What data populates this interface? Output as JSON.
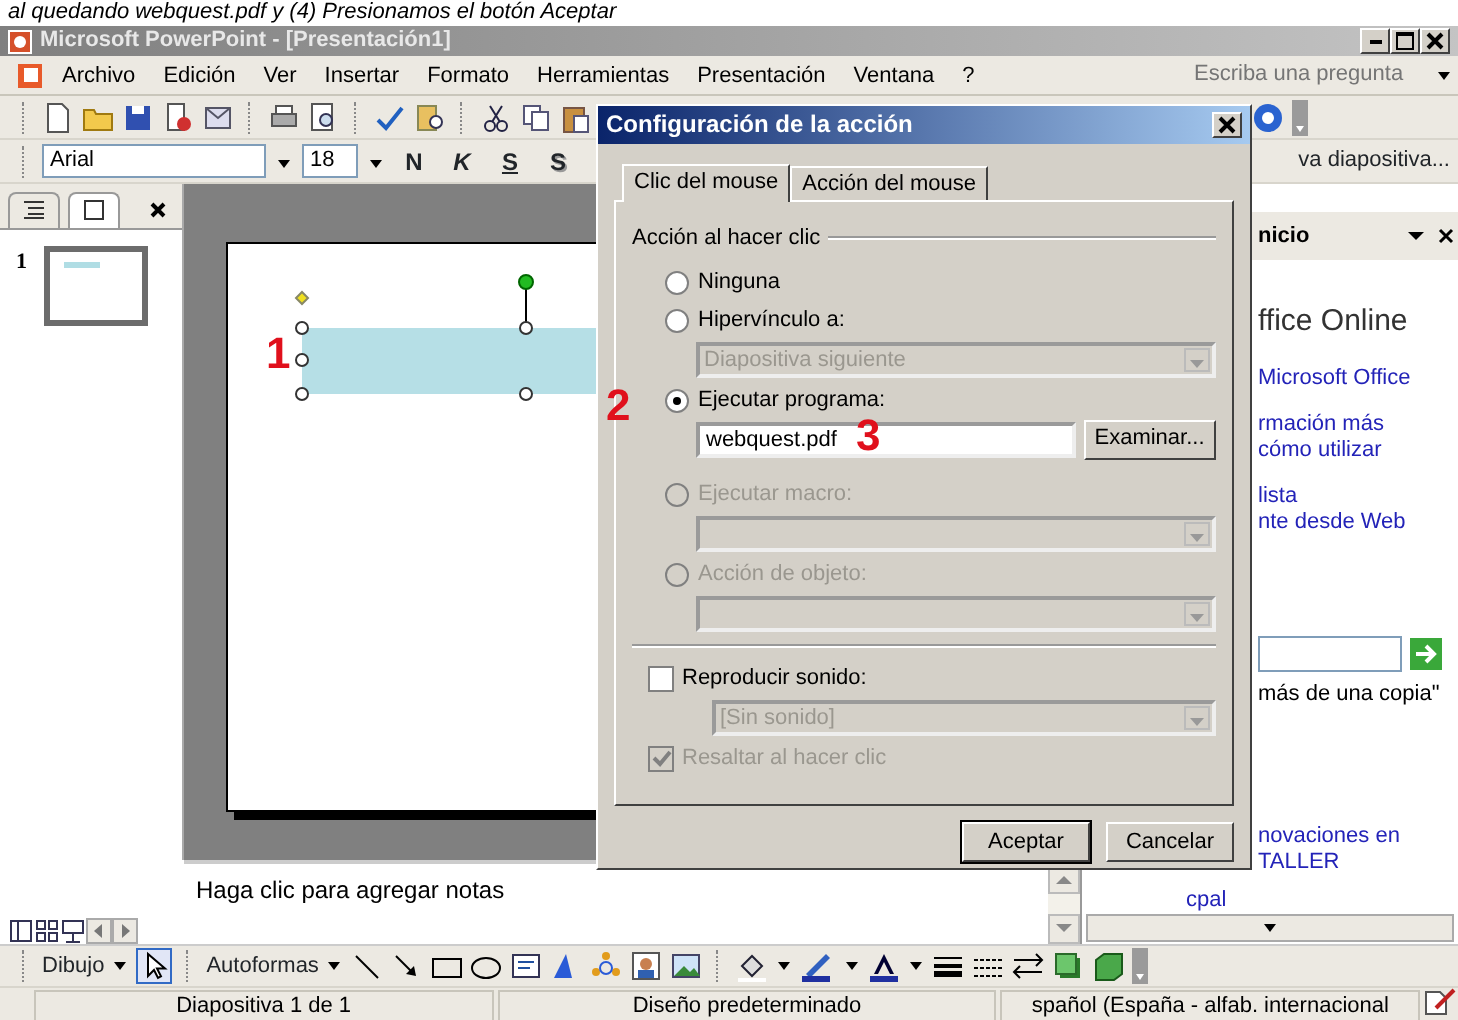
{
  "caption": "al quedando webquest.pdf y (4) Presionamos el botón Aceptar",
  "window": {
    "title": "Microsoft PowerPoint - [Presentación1]"
  },
  "menu": [
    "Archivo",
    "Edición",
    "Ver",
    "Insertar",
    "Formato",
    "Herramientas",
    "Presentación",
    "Ventana",
    "?"
  ],
  "help_box": {
    "placeholder": "Escriba una pregunta"
  },
  "formatting": {
    "font": "Arial",
    "size": "18",
    "styles": [
      "N",
      "K",
      "S",
      "S"
    ],
    "new_slide": "va diapositiva..."
  },
  "slides_pane": {
    "tabs": [
      {
        "kind": "outline",
        "selected": false
      },
      {
        "kind": "slides",
        "selected": true
      }
    ],
    "thumbnails": [
      {
        "number": "1",
        "selected": true
      }
    ]
  },
  "annotations": [
    "1",
    "2",
    "3"
  ],
  "dialog": {
    "title": "Configuración de la acción",
    "tabs": [
      {
        "label": "Clic del mouse",
        "selected": true
      },
      {
        "label": "Acción del mouse",
        "selected": false
      }
    ],
    "group": "Acción al hacer clic",
    "options": [
      {
        "kind": "radio",
        "label": "Ninguna",
        "selected": false,
        "disabled": false
      },
      {
        "kind": "radio",
        "label": "Hipervínculo a:",
        "selected": false,
        "disabled": false
      },
      {
        "kind": "select",
        "value": "Diapositiva siguiente",
        "disabled": true
      },
      {
        "kind": "radio",
        "label": "Ejecutar programa:",
        "selected": true,
        "disabled": false
      },
      {
        "kind": "file",
        "value": "webquest.pdf",
        "button": "Examinar..."
      },
      {
        "kind": "radio",
        "label": "Ejecutar macro:",
        "selected": false,
        "disabled": true
      },
      {
        "kind": "select",
        "disabled": true
      },
      {
        "kind": "radio",
        "label": "Acción de objeto:",
        "selected": false,
        "disabled": true
      },
      {
        "kind": "select",
        "disabled": true
      },
      {
        "kind": "rule"
      },
      {
        "kind": "checkbox",
        "label": "Reproducir sonido:",
        "checked": false,
        "disabled": false
      },
      {
        "kind": "select",
        "value": "[Sin sonido]",
        "disabled": true
      },
      {
        "kind": "checkbox",
        "label": "Resaltar al hacer clic",
        "checked": true,
        "disabled": true
      }
    ],
    "buttons": [
      {
        "label": "Aceptar",
        "default": true
      },
      {
        "label": "Cancelar",
        "default": false
      }
    ]
  },
  "task_pane": {
    "title": "nicio",
    "blocks": [
      {
        "kind": "title",
        "lines": [
          "ffice Online"
        ]
      },
      {
        "kind": "link",
        "lines": [
          "Microsoft Office"
        ]
      },
      {
        "kind": "link",
        "lines": [
          "rmación más",
          "cómo utilizar"
        ]
      },
      {
        "kind": "link",
        "lines": [
          "lista",
          "nte desde Web"
        ]
      },
      {
        "kind": "search"
      },
      {
        "kind": "text",
        "lines": [
          "más de una copia\""
        ]
      },
      {
        "kind": "link",
        "lines": [
          "novaciones en",
          "TALLER"
        ]
      },
      {
        "kind": "sublink",
        "lines": [
          "cpal"
        ]
      }
    ]
  },
  "notes": {
    "placeholder": "Haga clic para agregar notas"
  },
  "drawing_toolbar": {
    "draw": "Dibujo",
    "autoshapes": "Autoformas"
  },
  "status_bar": [
    "Diapositiva 1 de 1",
    "Diseño predeterminado",
    "spañol (España - alfab. internacional"
  ]
}
